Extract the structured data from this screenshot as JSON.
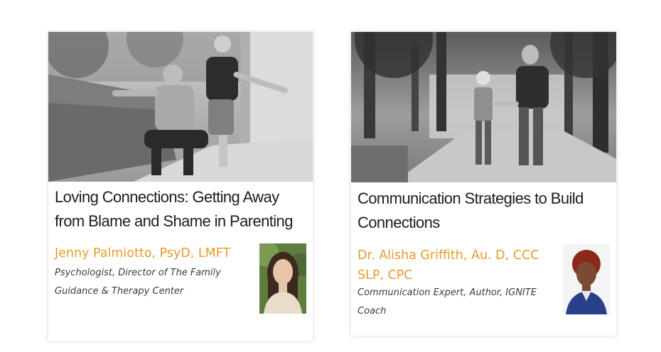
{
  "courses": [
    {
      "title": "Loving Connections: Getting Away from Blame and Shame in Parenting",
      "speaker_name": "Jenny Palmiotto, PsyD, LMFT",
      "speaker_role": "Psychologist, Director of The Family Guidance & Therapy Center",
      "accent_color": "#e69a2e"
    },
    {
      "title": "Communication Strategies to Build Connections",
      "speaker_name": "Dr. Alisha Griffith, Au. D, CCC SLP, CPC",
      "speaker_role": "Communication Expert, Author, IGNITE Coach",
      "accent_color": "#e69a2e"
    }
  ]
}
